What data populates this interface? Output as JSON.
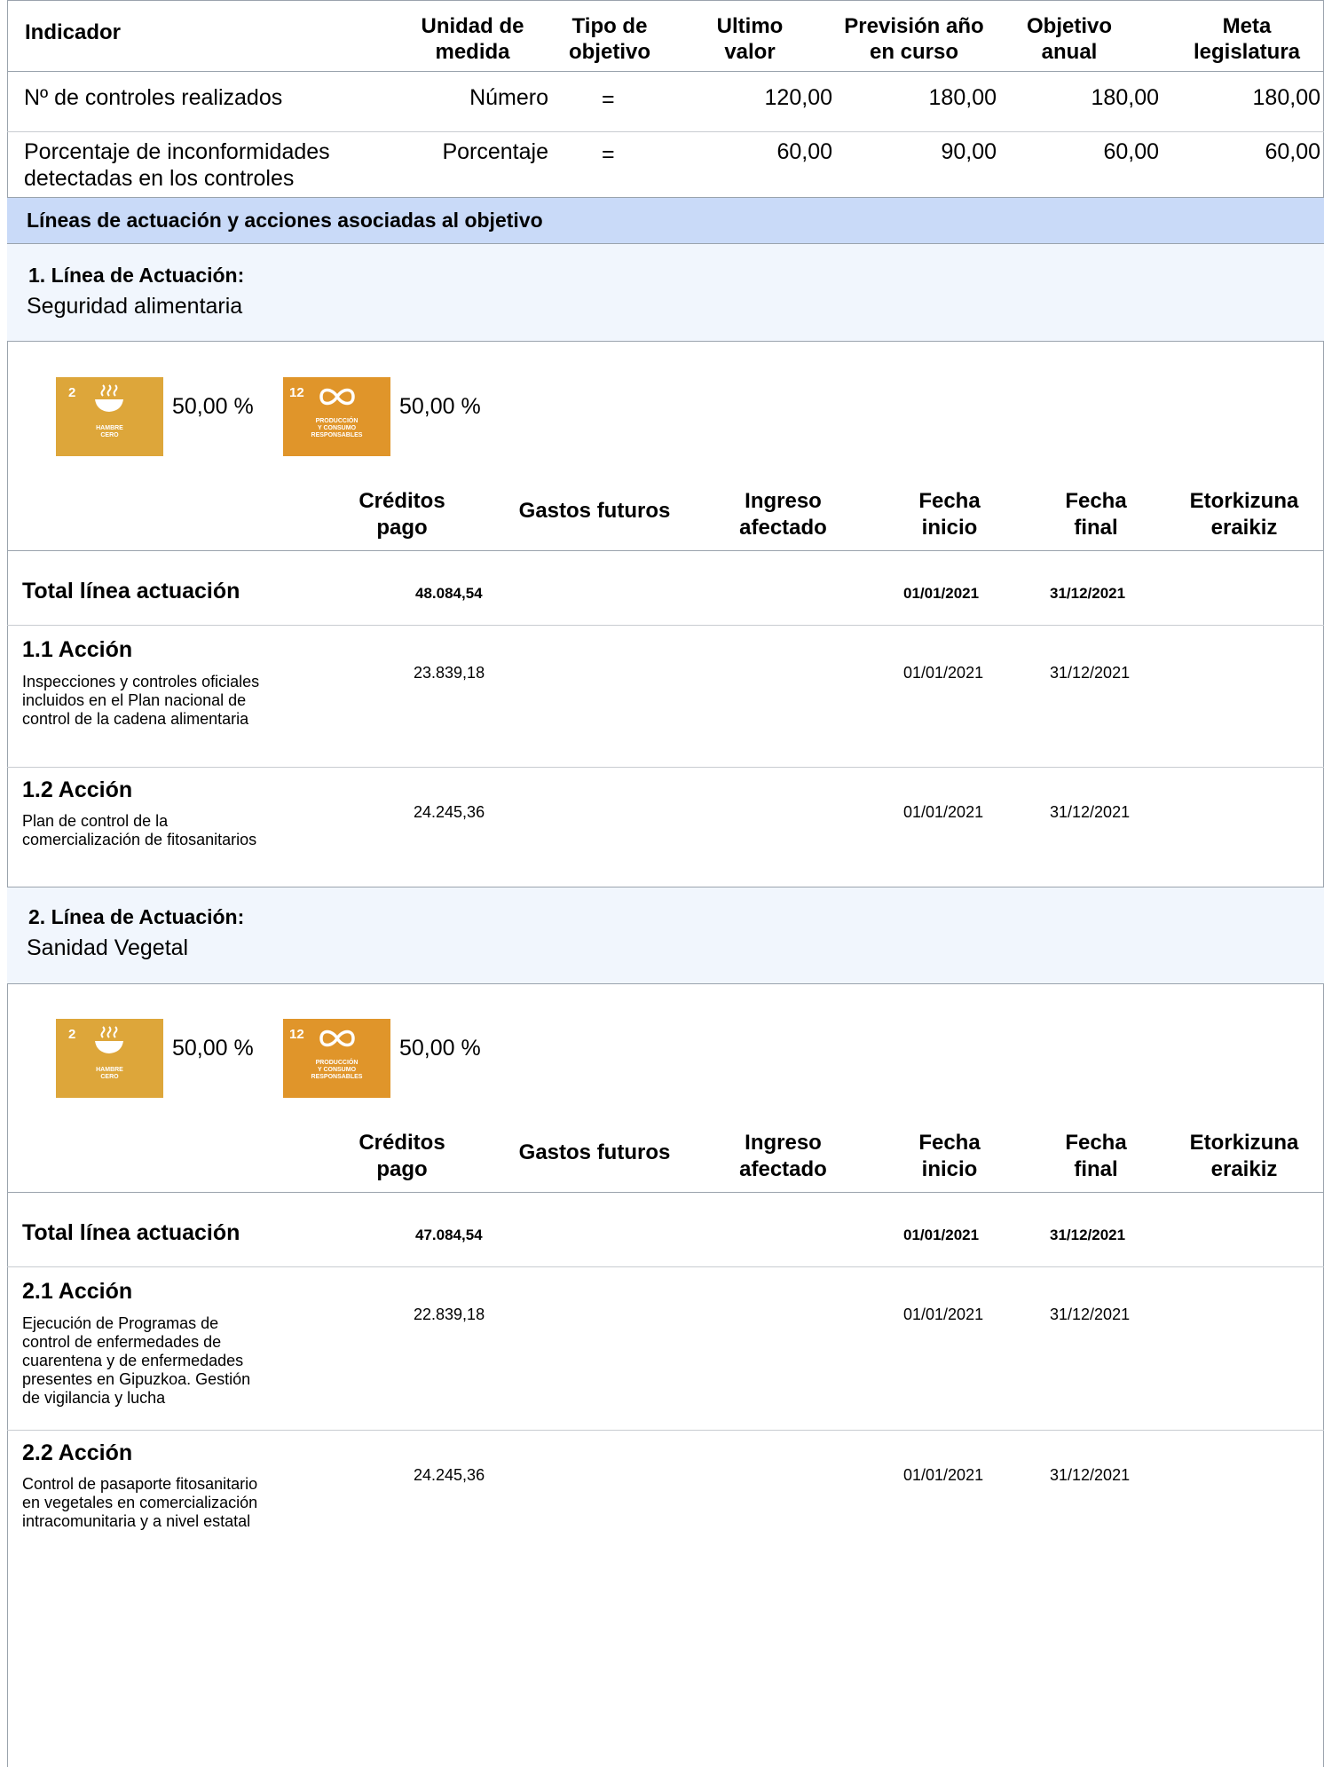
{
  "indicators": {
    "headers": {
      "indicador": "Indicador",
      "unidad_1": "Unidad de",
      "unidad_2": "medida",
      "tipo_1": "Tipo de",
      "tipo_2": "objetivo",
      "ultimo_1": "Ultimo",
      "ultimo_2": "valor",
      "prevision_1": "Previsión año",
      "prevision_2": "en curso",
      "objetivo_1": "Objetivo",
      "objetivo_2": "anual",
      "meta_1": "Meta",
      "meta_2": "legislatura"
    },
    "rows": [
      {
        "name_1": "Nº de controles realizados",
        "name_2": "",
        "unit": "Número",
        "type": "=",
        "last": "120,00",
        "forecast": "180,00",
        "annual": "180,00",
        "goal": "180,00"
      },
      {
        "name_1": "Porcentaje de inconformidades",
        "name_2": "detectadas en los controles",
        "unit": "Porcentaje",
        "type": "=",
        "last": "60,00",
        "forecast": "90,00",
        "annual": "60,00",
        "goal": "60,00"
      }
    ]
  },
  "section_title": "Líneas de actuación y acciones asociadas al objetivo",
  "sdg_icons": {
    "sdg2": {
      "number": "2",
      "caption_1": "HAMBRE",
      "caption_2": "CERO",
      "icon": "bowl-icon",
      "color": "#dda63a"
    },
    "sdg12": {
      "number": "12",
      "caption_1": "PRODUCCIÓN",
      "caption_2": "Y CONSUMO",
      "caption_3": "RESPONSABLES",
      "icon": "infinity-icon",
      "color": "#e0952a"
    }
  },
  "fin_headers": {
    "creditos_1": "Créditos",
    "creditos_2": "pago",
    "gastos": "Gastos futuros",
    "ingreso_1": "Ingreso",
    "ingreso_2": "afectado",
    "fecha_inicio_1": "Fecha",
    "fecha_inicio_2": "inicio",
    "fecha_final_1": "Fecha",
    "fecha_final_2": "final",
    "etorkizuna_1": "Etorkizuna",
    "etorkizuna_2": "eraikiz"
  },
  "lineas": [
    {
      "title": "1. Línea de Actuación:",
      "name": "Seguridad alimentaria",
      "sdg2_pct": "50,00 %",
      "sdg12_pct": "50,00 %",
      "total_label": "Total línea actuación",
      "total_credits": "48.084,54",
      "total_start": "01/01/2021",
      "total_end": "31/12/2021",
      "acciones": [
        {
          "title": "1.1 Acción",
          "desc_lines": [
            "Inspecciones y controles oficiales",
            "incluidos en el Plan nacional de",
            "control de la cadena alimentaria"
          ],
          "credits": "23.839,18",
          "start": "01/01/2021",
          "end": "31/12/2021"
        },
        {
          "title": "1.2 Acción",
          "desc_lines": [
            "Plan de control de la",
            "comercialización de fitosanitarios"
          ],
          "credits": "24.245,36",
          "start": "01/01/2021",
          "end": "31/12/2021"
        }
      ]
    },
    {
      "title": "2. Línea de Actuación:",
      "name": "Sanidad Vegetal",
      "sdg2_pct": "50,00 %",
      "sdg12_pct": "50,00 %",
      "total_label": "Total línea actuación",
      "total_credits": "47.084,54",
      "total_start": "01/01/2021",
      "total_end": "31/12/2021",
      "acciones": [
        {
          "title": "2.1 Acción",
          "desc_lines": [
            "Ejecución de  Programas de",
            "control de enfermedades de",
            "cuarentena y de enfermedades",
            "presentes en Gipuzkoa. Gestión",
            "de vigilancia y lucha"
          ],
          "credits": "22.839,18",
          "start": "01/01/2021",
          "end": "31/12/2021"
        },
        {
          "title": "2.2 Acción",
          "desc_lines": [
            "Control de pasaporte fitosanitario",
            "en vegetales en comercialización",
            "intracomunitaria y a nivel estatal"
          ],
          "credits": "24.245,36",
          "start": "01/01/2021",
          "end": "31/12/2021"
        }
      ]
    }
  ]
}
